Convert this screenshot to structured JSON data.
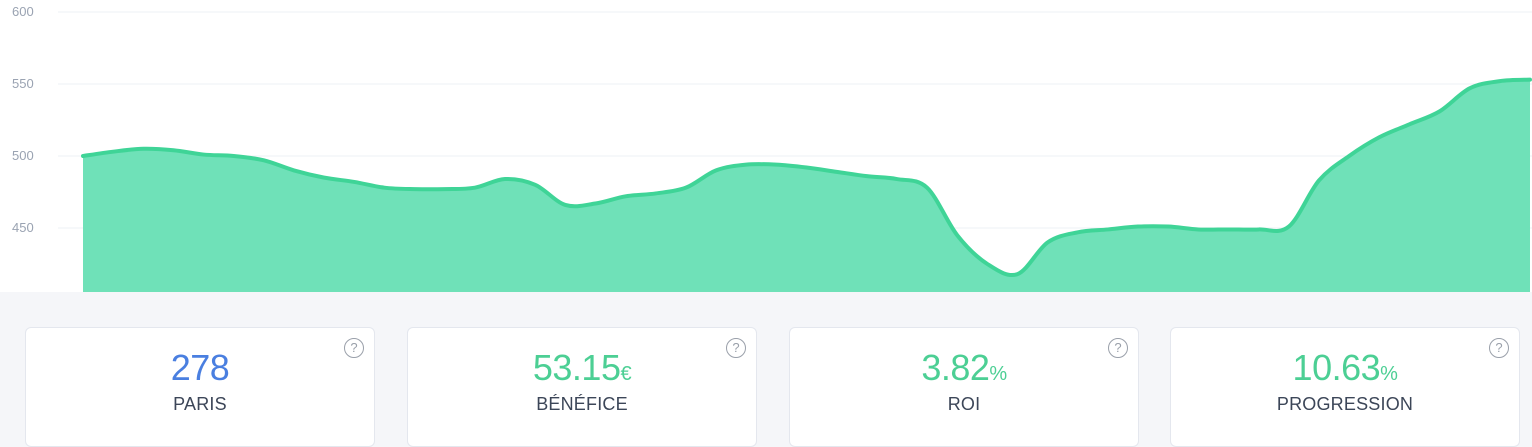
{
  "chart_data": {
    "type": "area",
    "title": "",
    "xlabel": "",
    "ylabel": "",
    "ylim": [
      405,
      600
    ],
    "yticks": [
      450,
      500,
      550,
      600
    ],
    "grid": true,
    "x": [
      0,
      1,
      2,
      3,
      4,
      5,
      6,
      7,
      8,
      9,
      10,
      11,
      12,
      13,
      14,
      15,
      16,
      17,
      18,
      19,
      20,
      21,
      22,
      23,
      24,
      25,
      26,
      27,
      28,
      29,
      30,
      31,
      32,
      33,
      34,
      35,
      36,
      37,
      38,
      39,
      40,
      41,
      42,
      43,
      44,
      45,
      46,
      47,
      48
    ],
    "series": [
      {
        "name": "",
        "color": "#3fd497",
        "fill": "#6fe1b8",
        "values": [
          500,
          503,
          505,
          504,
          501,
          500,
          497,
          490,
          485,
          482,
          478,
          477,
          477,
          478,
          484,
          480,
          466,
          467,
          472,
          474,
          478,
          490,
          494,
          494,
          492,
          489,
          486,
          484,
          478,
          445,
          425,
          418,
          440,
          447,
          449,
          451,
          451,
          449,
          449,
          449,
          451,
          483,
          500,
          513,
          522,
          531,
          547,
          552,
          553
        ]
      }
    ]
  },
  "stats": [
    {
      "value": "278",
      "unit": "",
      "label": "PARIS",
      "color": "#4a7fe0",
      "help": "?"
    },
    {
      "value": "53.15",
      "unit": "€",
      "label": "BÉNÉFICE",
      "color": "#4ccf94",
      "help": "?"
    },
    {
      "value": "3.82",
      "unit": "%",
      "label": "ROI",
      "color": "#4ccf94",
      "help": "?"
    },
    {
      "value": "10.63",
      "unit": "%",
      "label": "PROGRESSION",
      "color": "#4ccf94",
      "help": "?"
    }
  ]
}
